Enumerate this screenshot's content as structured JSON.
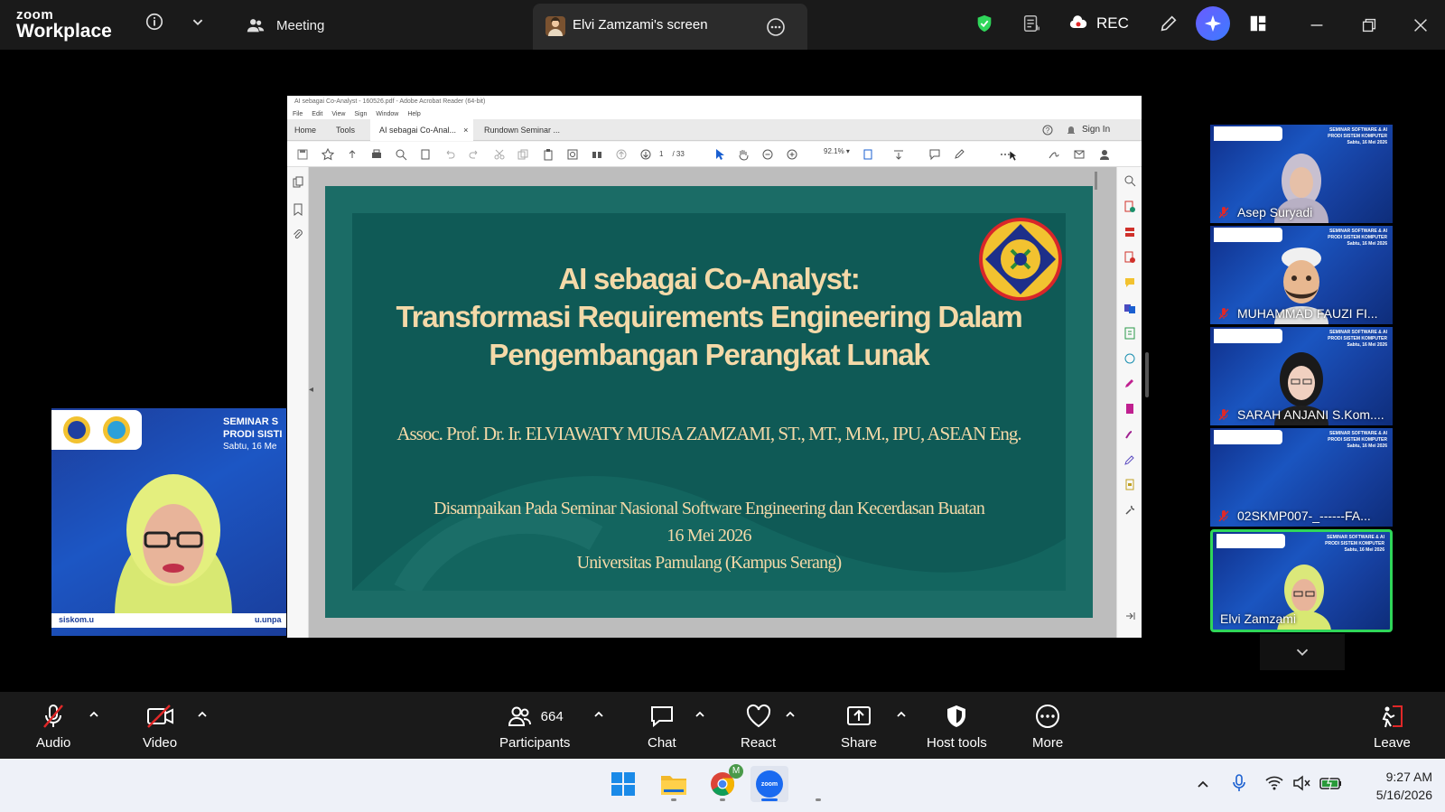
{
  "window": {
    "logo_line1": "zoom",
    "logo_line2": "Workplace",
    "meeting_label": "Meeting",
    "screen_tab_label": "Elvi Zamzami's screen",
    "rec_label": "REC"
  },
  "acrobat": {
    "title": "AI sebagai Co-Analyst - 160526.pdf - Adobe Acrobat Reader (64-bit)",
    "menu": [
      "File",
      "Edit",
      "View",
      "Sign",
      "Window",
      "Help"
    ],
    "tabs": [
      "Home",
      "Tools",
      "AI sebagai Co-Anal...",
      "Rundown Seminar ..."
    ],
    "signin": "Sign In",
    "page_current": "1",
    "page_total": "/ 33",
    "zoom": "92.1%"
  },
  "slide": {
    "title_line1": "AI sebagai Co-Analyst:",
    "title_line2": "Transformasi Requirements Engineering Dalam",
    "title_line3": "Pengembangan Perangkat Lunak",
    "author": "Assoc. Prof. Dr. Ir. ELVIAWATY MUISA ZAMZAMI, ST., MT., M.M., IPU, ASEAN Eng.",
    "event_line1": "Disampaikan Pada Seminar Nasional  Software Engineering dan Kecerdasan Buatan",
    "event_line2": "16 Mei 2026",
    "event_line3": "Universitas Pamulang (Kampus Serang)"
  },
  "presenter": {
    "banner_line1": "SEMINAR S",
    "banner_line2": "PRODI SISTI",
    "banner_line3": "Sabtu, 16 Me",
    "strip_left": "siskom.u",
    "strip_right": "u.unpa"
  },
  "gallery": {
    "tile_banner_line1": "SEMINAR SOFTWARE & AI",
    "tile_banner_line2": "PRODI SISTEM KOMPUTER",
    "tile_banner_line3": "Sabtu, 16 Mei 2026",
    "participants": [
      {
        "name": "Asep Suryadi",
        "muted": true
      },
      {
        "name": "MUHAMMAD FAUZI FI...",
        "muted": true
      },
      {
        "name": "SARAH ANJANI S.Kom....",
        "muted": true
      },
      {
        "name": "02SKMP007-_------FA...",
        "muted": true
      },
      {
        "name": "Elvi Zamzami",
        "muted": false,
        "active": true
      }
    ]
  },
  "controls": {
    "audio": "Audio",
    "video": "Video",
    "participants": "Participants",
    "participants_count": "664",
    "chat": "Chat",
    "react": "React",
    "share": "Share",
    "host_tools": "Host tools",
    "more": "More",
    "leave": "Leave"
  },
  "taskbar": {
    "time": "9:27 AM",
    "date": "5/16/2026",
    "zoom_app_label": "zoom",
    "chrome_badge": "M"
  },
  "colors": {
    "zoom_topbar": "#1a1a1a",
    "slide_bg": "#1b6c66",
    "slide_text": "#f4d9a8",
    "active_border": "#2fd65a",
    "shield_green": "#2fd65a",
    "leave_red": "#e02828"
  }
}
